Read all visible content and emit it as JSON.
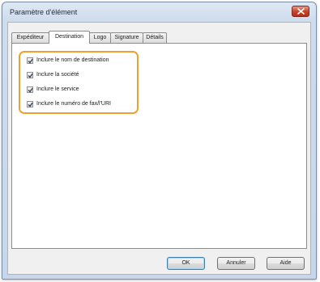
{
  "window": {
    "title": "Paramètre d'élément"
  },
  "tabs": [
    {
      "label": "Expéditeur",
      "active": false
    },
    {
      "label": "Destination",
      "active": true
    },
    {
      "label": "Logo",
      "active": false
    },
    {
      "label": "Signature",
      "active": false
    },
    {
      "label": "Détails",
      "active": false
    }
  ],
  "options": [
    {
      "label": "Inclure le nom de destination",
      "checked": true
    },
    {
      "label": "Inclure la société",
      "checked": true
    },
    {
      "label": "Inclure le service",
      "checked": true
    },
    {
      "label": "Inclure le numéro de fax/l'URI",
      "checked": true
    }
  ],
  "buttons": {
    "ok": "OK",
    "cancel": "Annuler",
    "help": "Aide"
  },
  "colors": {
    "highlight": "#f0a030",
    "close": "#c9452c"
  },
  "icons": {
    "close": "close-icon",
    "check": "checkmark-icon"
  }
}
